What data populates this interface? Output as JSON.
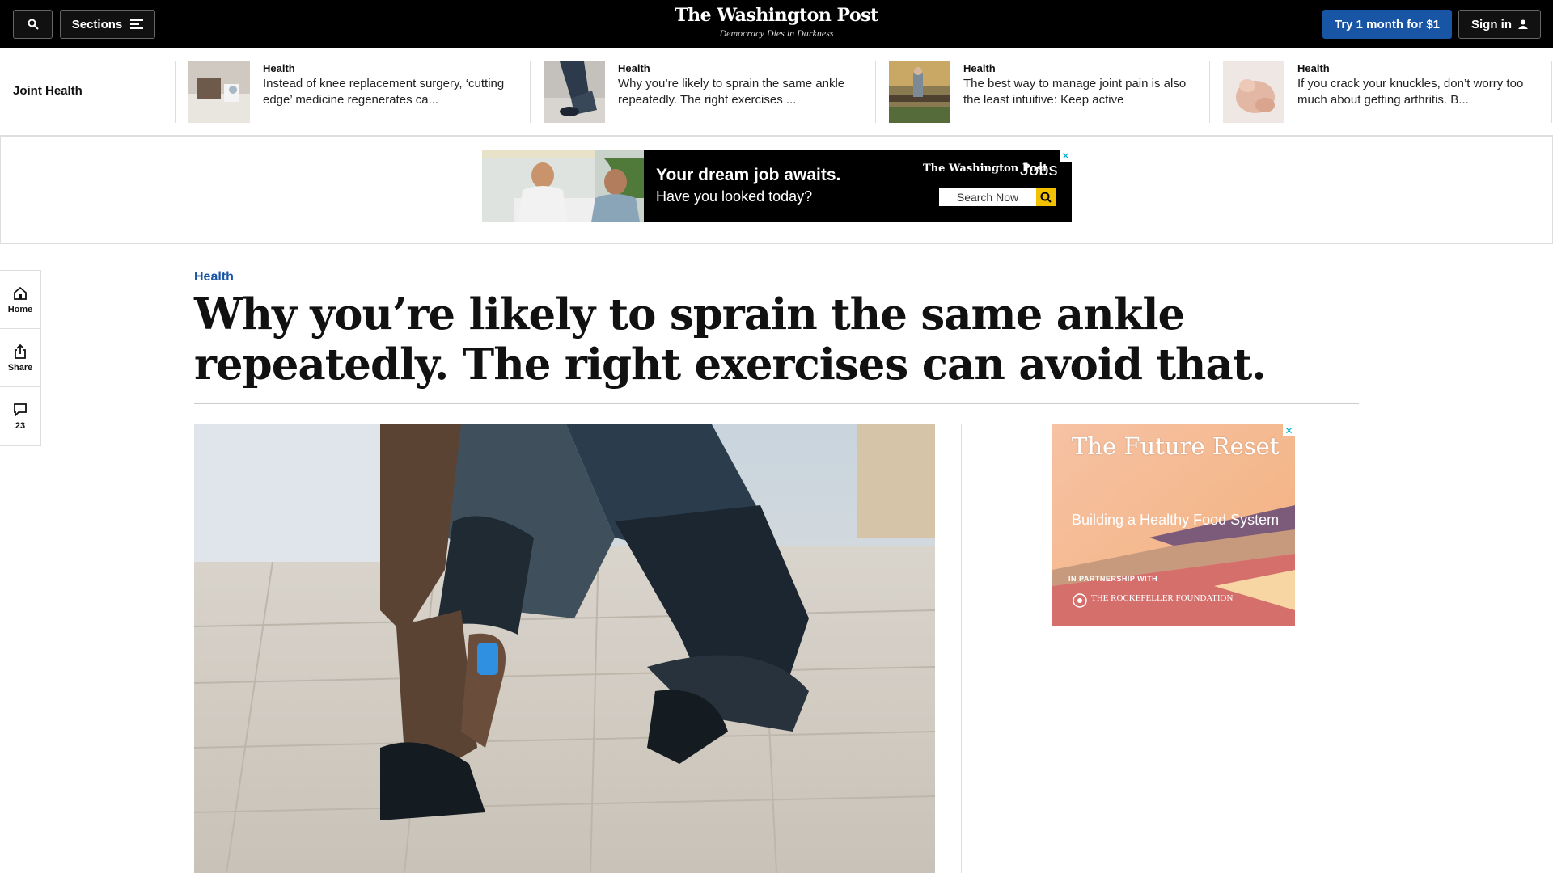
{
  "header": {
    "sections_label": "Sections",
    "logo": "The Washington Post",
    "tagline": "Democracy Dies in Darkness",
    "subscribe_label": "Try 1 month for $1",
    "signin_label": "Sign in"
  },
  "strip": {
    "label": "Joint Health",
    "items": [
      {
        "kicker": "Health",
        "title": "Instead of knee replacement surgery, ‘cutting edge’ medicine regenerates ca..."
      },
      {
        "kicker": "Health",
        "title": "Why you’re likely to sprain the same ankle repeatedly. The right exercises ..."
      },
      {
        "kicker": "Health",
        "title": "The best way to manage joint pain is also the least intuitive: Keep active"
      },
      {
        "kicker": "Health",
        "title": "If you crack your knuckles, don’t worry too much about getting arthritis. B..."
      }
    ]
  },
  "ad_banner": {
    "headline": "Your dream job awaits.",
    "subline": "Have you looked today?",
    "brand": "The Washington Post",
    "product": "Jobs",
    "search_label": "Search Now"
  },
  "rail": {
    "home": "Home",
    "share": "Share",
    "comments": "23"
  },
  "article": {
    "kicker": "Health",
    "headline": "Why you’re likely to sprain the same ankle repeatedly. The right exercises can avoid that."
  },
  "side_ad": {
    "title": "The Future Reset",
    "subtitle": "Building a Healthy Food System",
    "partner": "IN PARTNERSHIP WITH",
    "partner_name": "THE ROCKEFELLER FOUNDATION"
  },
  "colors": {
    "accent": "#1955a5",
    "topbar": "#000000"
  }
}
